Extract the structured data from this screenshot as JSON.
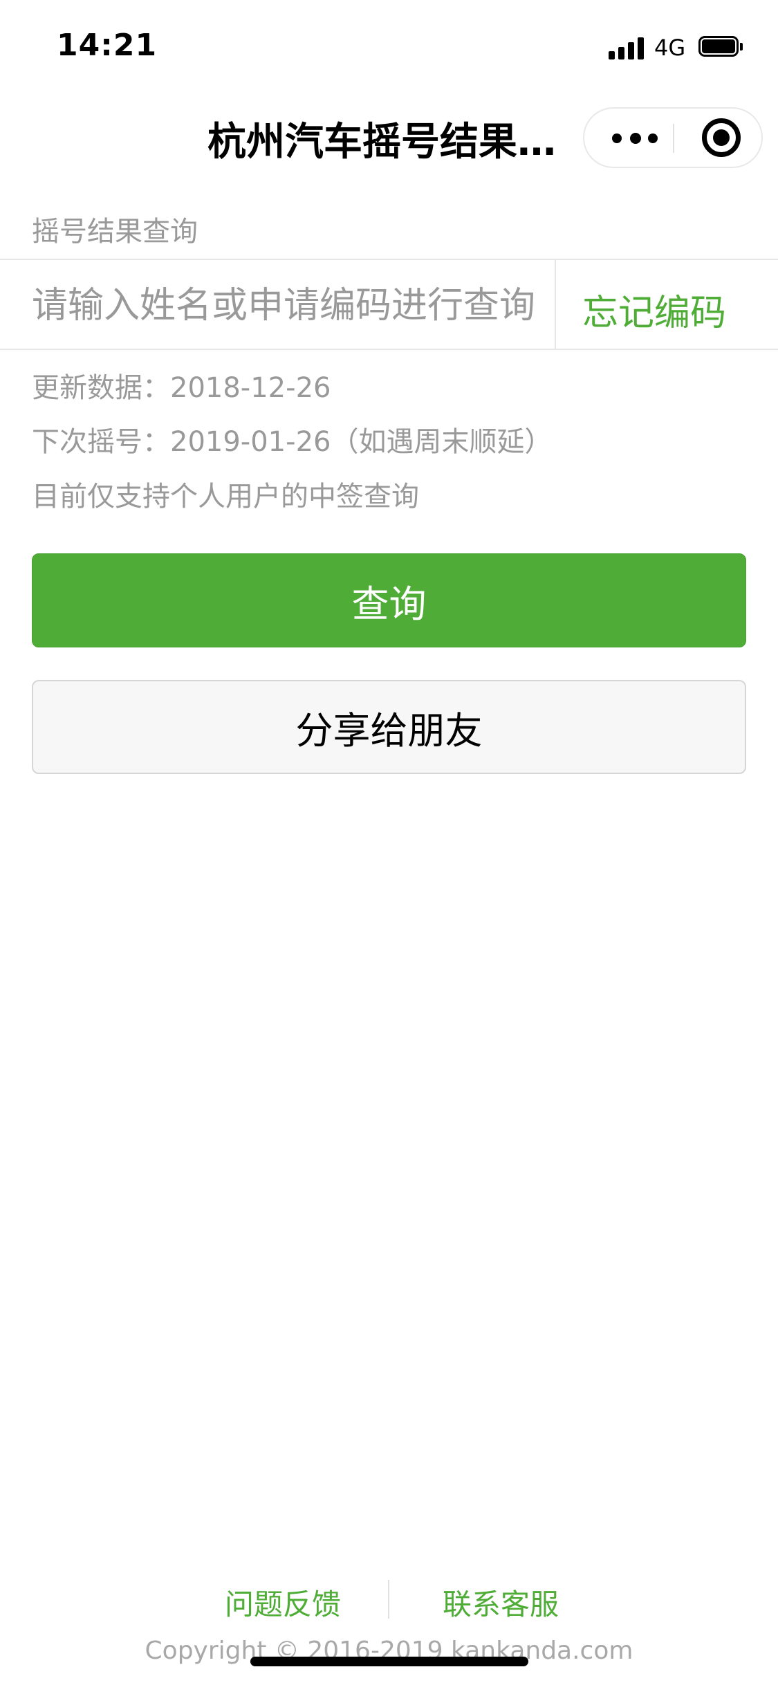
{
  "status_bar": {
    "time": "14:21",
    "network": "4G"
  },
  "nav": {
    "title": "杭州汽车摇号结果查询"
  },
  "form": {
    "section_label": "摇号结果查询",
    "search_placeholder": "请输入姓名或申请编码进行查询",
    "forgot_code": "忘记编码"
  },
  "info": {
    "update_label": "更新数据：",
    "update_date": "2018-12-26",
    "next_label": "下次摇号：",
    "next_date": "2019-01-26（如遇周末顺延）",
    "note": "目前仅支持个人用户的中签查询"
  },
  "buttons": {
    "query": "查询",
    "share": "分享给朋友"
  },
  "footer": {
    "feedback": "问题反馈",
    "contact": "联系客服",
    "copyright": "Copyright © 2016-2019 kankanda.com"
  },
  "colors": {
    "accent": "#4fad37",
    "muted_text": "#999999"
  }
}
